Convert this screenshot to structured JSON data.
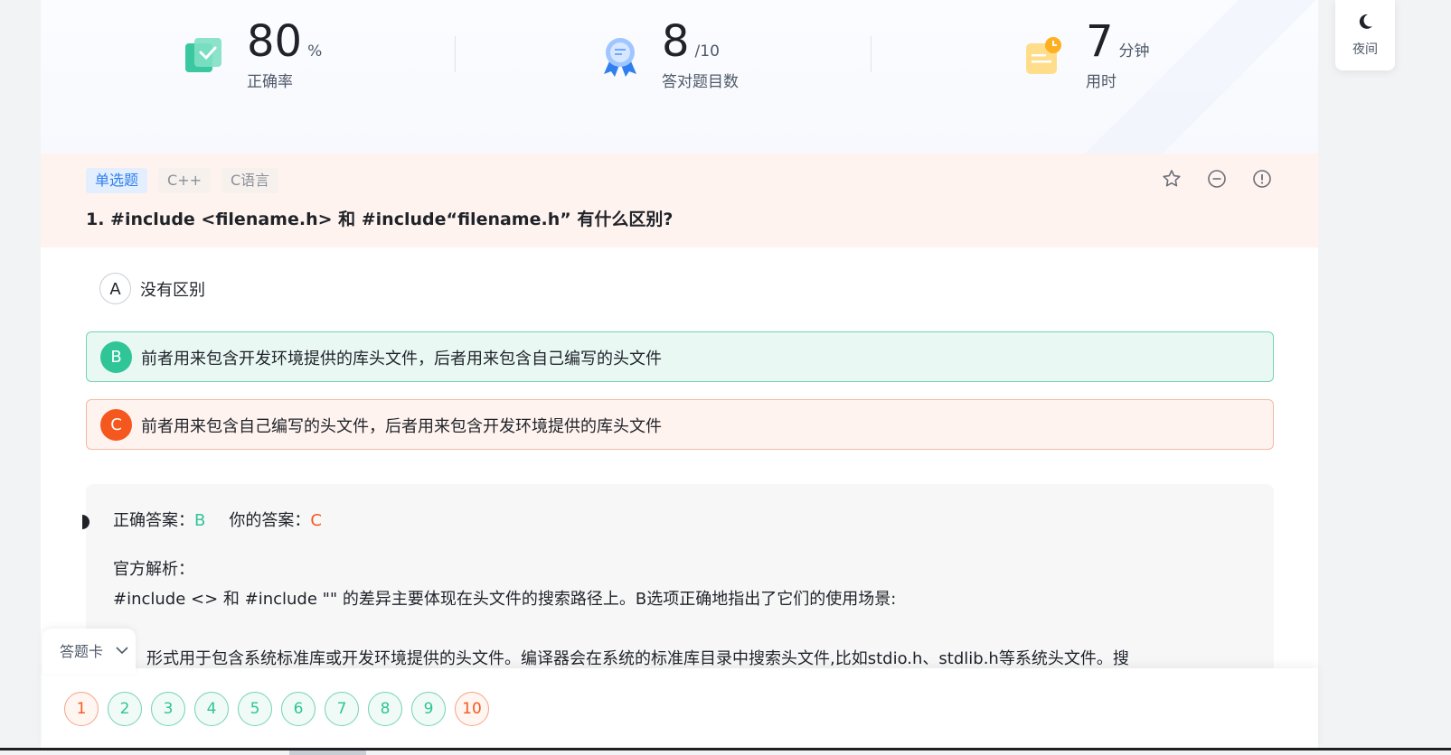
{
  "stats": {
    "accuracy": {
      "value": "80",
      "unit": "%",
      "label": "正确率"
    },
    "correct_count": {
      "value": "8",
      "unit": "/10",
      "label": "答对题目数"
    },
    "time": {
      "value": "7",
      "unit": "分钟",
      "label": "用时"
    }
  },
  "night_mode": {
    "label": "夜间"
  },
  "question": {
    "tags": [
      "单选题",
      "C++",
      "C语言"
    ],
    "title": "1. #include <filename.h>  和 #include“filename.h” 有什么区别?",
    "actions": [
      "star-icon",
      "minus-circle-icon",
      "alert-circle-icon"
    ]
  },
  "options": [
    {
      "letter": "A",
      "text": "没有区别",
      "state": "none"
    },
    {
      "letter": "B",
      "text": "前者用来包含开发环境提供的库头文件，后者用来包含自己编写的头文件",
      "state": "correct"
    },
    {
      "letter": "C",
      "text": "前者用来包含自己编写的头文件，后者用来包含开发环境提供的库头文件",
      "state": "wrong"
    }
  ],
  "analysis": {
    "correct_label": "正确答案：",
    "correct_value": "B",
    "yours_label": "你的答案：",
    "yours_value": "C",
    "title": "官方解析：",
    "text1": "#include <> 和 #include \"\" 的差异主要体现在头文件的搜索路径上。B选项正确地指出了它们的使用场景:",
    "text2": "形式用于包含系统标准库或开发环境提供的头文件。编译器会在系统的标准库目录中搜索头文件,比如stdio.h、stdlib.h等系统头文件。搜"
  },
  "answer_card": {
    "label": "答题卡",
    "items": [
      {
        "n": "1",
        "state": "wrong"
      },
      {
        "n": "2",
        "state": "correct"
      },
      {
        "n": "3",
        "state": "correct"
      },
      {
        "n": "4",
        "state": "correct"
      },
      {
        "n": "5",
        "state": "correct"
      },
      {
        "n": "6",
        "state": "correct"
      },
      {
        "n": "7",
        "state": "correct"
      },
      {
        "n": "8",
        "state": "correct"
      },
      {
        "n": "9",
        "state": "correct"
      },
      {
        "n": "10",
        "state": "wrong"
      }
    ]
  },
  "colors": {
    "correct": "#2fc596",
    "wrong": "#f5581f",
    "accent": "#2f7fef"
  }
}
